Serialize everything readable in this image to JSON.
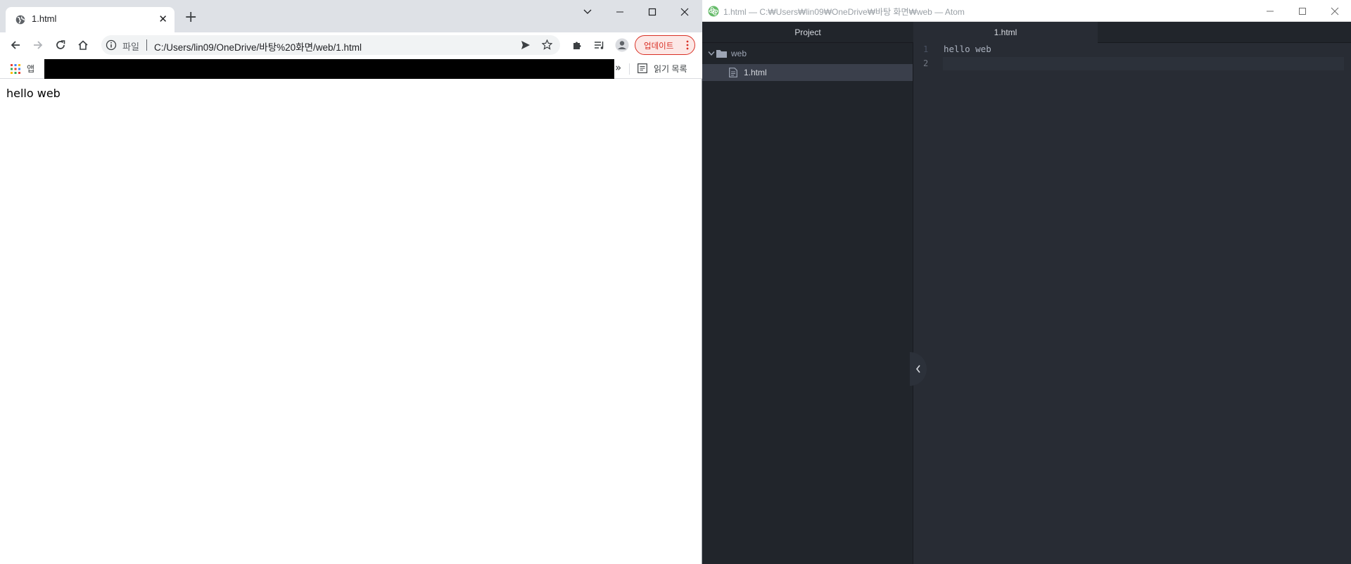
{
  "browser": {
    "tab": {
      "title": "1.html",
      "favicon": "globe-icon",
      "close": "✕"
    },
    "new_tab": "+",
    "omnibox": {
      "scheme_label": "파일",
      "url": "C:/Users/lin09/OneDrive/바탕%20화면/web/1.html"
    },
    "update_button": "업데이트",
    "bookmarks": {
      "apps_label": "앱",
      "more": "»",
      "reading_list": "읽기 목록"
    },
    "page": {
      "text": "hello web"
    },
    "colors": {
      "update_accent": "#d93025",
      "tabstrip": "#dee1e6"
    }
  },
  "atom": {
    "window_title": "1.html — C:₩Users₩lin09₩OneDrive₩바탕 화면₩web — Atom",
    "tree": {
      "header": "Project",
      "folder": "web",
      "file": "1.html"
    },
    "editor": {
      "tab_title": "1.html",
      "lines": [
        {
          "number": "1",
          "text": "hello web"
        },
        {
          "number": "2",
          "text": ""
        }
      ]
    },
    "colors": {
      "background": "#282c34",
      "panel": "#21252b",
      "text": "#abb2bf"
    }
  }
}
